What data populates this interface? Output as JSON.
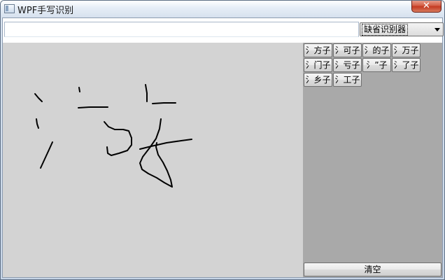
{
  "window": {
    "title": "WPF手写识别",
    "close_glyph": "✕"
  },
  "input": {
    "text": ""
  },
  "recognizer": {
    "selected": "缺省识别器"
  },
  "candidates": [
    {
      "label": "氵方子"
    },
    {
      "label": "氵可子"
    },
    {
      "label": "氵的子"
    },
    {
      "label": "氵万子"
    },
    {
      "label": "氵门子"
    },
    {
      "label": "氵亏子"
    },
    {
      "label": "氵”子"
    },
    {
      "label": "氵了子"
    },
    {
      "label": "氵乡子"
    },
    {
      "label": "氵工子"
    }
  ],
  "actions": {
    "clear_label": "清空"
  },
  "colors": {
    "canvas_bg": "#d3d3d3",
    "panel_bg": "#a9a9a9",
    "ink": "#000000"
  }
}
